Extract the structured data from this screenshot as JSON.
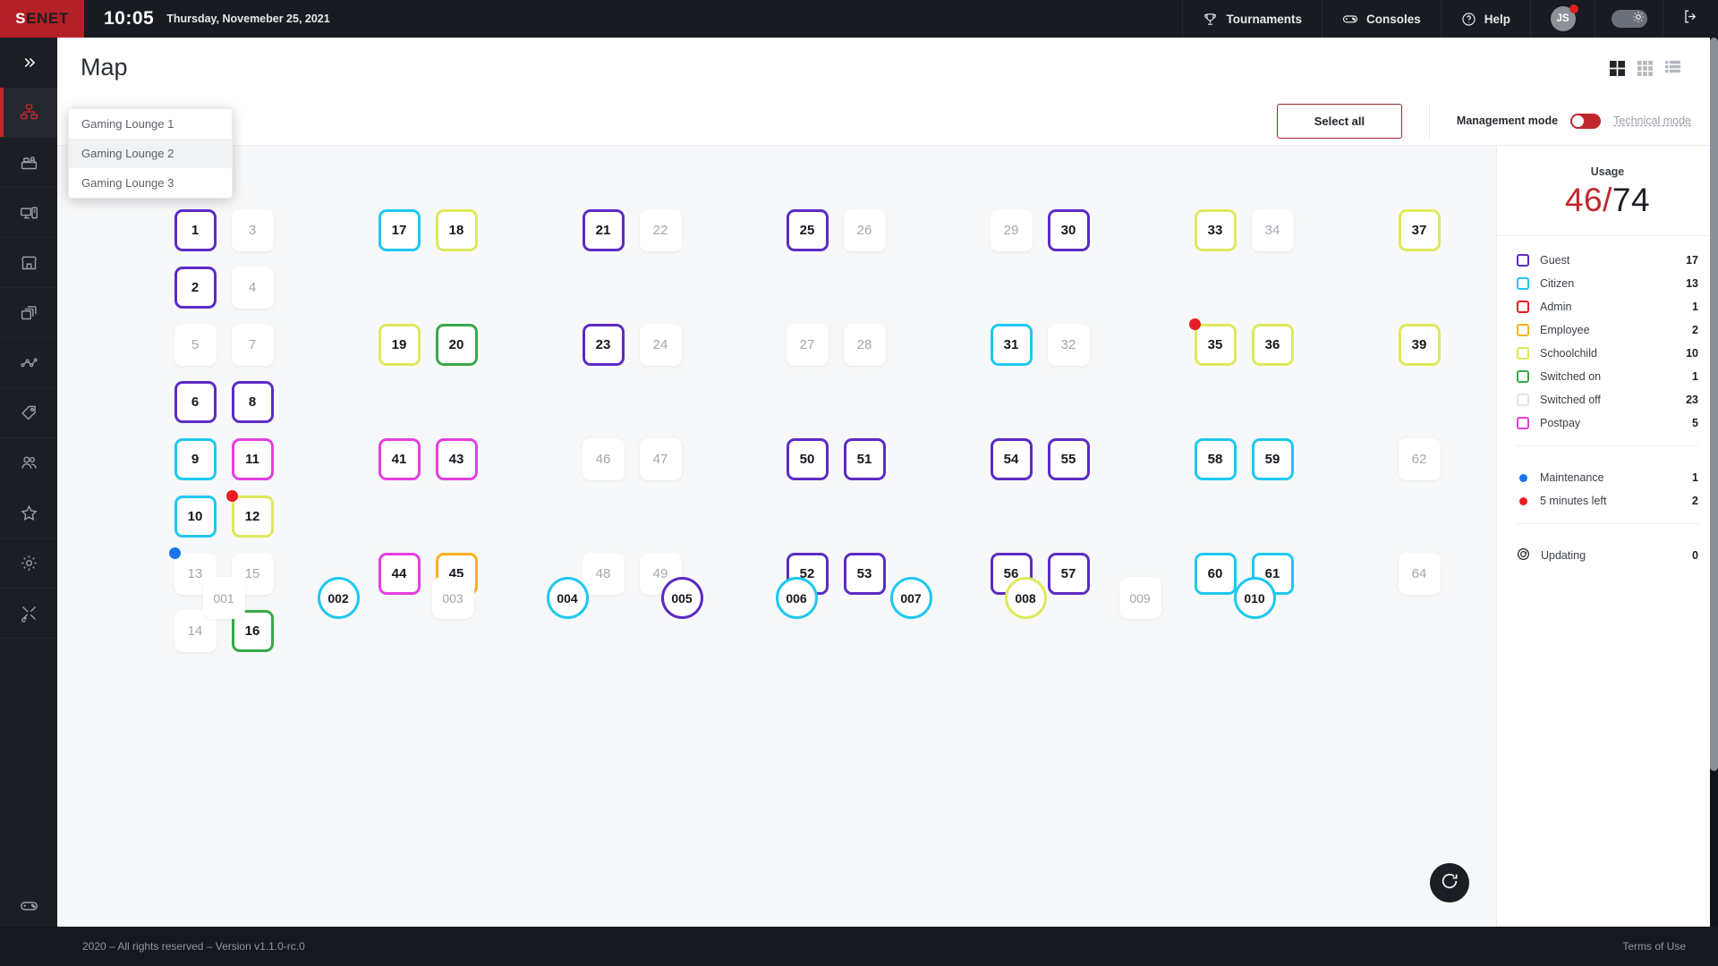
{
  "topbar": {
    "logo": "SENET",
    "logo_first_letter": "S",
    "logo_rest": "ENET",
    "clock": "10:05",
    "date": "Thursday, Novemeber 25, 2021",
    "items": [
      {
        "label": "Tournaments",
        "icon": "trophy-icon"
      },
      {
        "label": "Consoles",
        "icon": "gamepad-icon"
      },
      {
        "label": "Help",
        "icon": "help-circle-icon"
      }
    ],
    "avatar_initials": "JS",
    "theme_icon": "sun-icon",
    "logout_icon": "logout-icon"
  },
  "sidebar": {
    "expand_icon": "double-chevron-right-icon",
    "items": [
      {
        "icon": "network-map-icon",
        "name": "map",
        "active": true
      },
      {
        "icon": "reception-desk-icon",
        "name": "reception",
        "active": false
      },
      {
        "icon": "computer-icon",
        "name": "consoles",
        "active": false
      },
      {
        "icon": "shop-icon",
        "name": "shop",
        "active": false
      },
      {
        "icon": "layers-icon",
        "name": "layers",
        "active": false
      },
      {
        "icon": "analytics-icon",
        "name": "analytics",
        "active": false
      },
      {
        "icon": "tag-icon",
        "name": "pricing",
        "active": false
      },
      {
        "icon": "users-icon",
        "name": "users",
        "active": false
      },
      {
        "icon": "star-icon",
        "name": "favorites",
        "active": false
      },
      {
        "icon": "gear-icon",
        "name": "settings",
        "active": false
      },
      {
        "icon": "tools-icon",
        "name": "tools",
        "active": false
      }
    ],
    "bottom_items": [
      {
        "icon": "gamepad-icon",
        "name": "games",
        "active": false
      }
    ]
  },
  "page": {
    "title": "Map",
    "view_modes": [
      {
        "name": "grid-large",
        "active": true
      },
      {
        "name": "grid-small",
        "active": false
      },
      {
        "name": "list",
        "active": false
      }
    ]
  },
  "lounge_dropdown": {
    "options": [
      {
        "label": "Gaming Lounge 1",
        "selected": false
      },
      {
        "label": "Gaming Lounge 2",
        "selected": true
      },
      {
        "label": "Gaming Lounge 3",
        "selected": false
      }
    ]
  },
  "toolbar": {
    "select_all_label": "Select all",
    "management_mode_label": "Management mode",
    "management_mode_on": true,
    "technical_mode_label": "Technical mode"
  },
  "colors": {
    "guest": "#5B2BC4",
    "citizen": "#1EC8F0",
    "admin": "#ED1C24",
    "employee": "#F6B223",
    "schoolchild": "#DDE95C",
    "switched_on": "#38A84A",
    "switched_off": "#FFFFFF",
    "postpay": "#E33FE0",
    "maintenance": "#1976EA",
    "expiring": "#EC1C24",
    "brand_red": "#C0272D"
  },
  "usage": {
    "label": "Usage",
    "used": "46",
    "separator": "/",
    "total": "74"
  },
  "legend": {
    "categories": [
      {
        "label": "Guest",
        "count": "17",
        "color": "#5B2BC4"
      },
      {
        "label": "Citizen",
        "count": "13",
        "color": "#1EC8F0"
      },
      {
        "label": "Admin",
        "count": "1",
        "color": "#ED1C24"
      },
      {
        "label": "Employee",
        "count": "2",
        "color": "#F6B223"
      },
      {
        "label": "Schoolchild",
        "count": "10",
        "color": "#DDE95C"
      },
      {
        "label": "Switched on",
        "count": "1",
        "color": "#38A84A"
      },
      {
        "label": "Switched off",
        "count": "23",
        "color": "#E2E4E7"
      },
      {
        "label": "Postpay",
        "count": "5",
        "color": "#E33FE0"
      }
    ],
    "statuses": [
      {
        "label": "Maintenance",
        "count": "1",
        "color": "#1976EA"
      },
      {
        "label": "5 minutes left",
        "count": "2",
        "color": "#EC1C24"
      }
    ],
    "updating": {
      "label": "Updating",
      "count": "0",
      "icon": "refresh-icon"
    }
  },
  "stations": {
    "groups": [
      {
        "cells": [
          {
            "id": "1",
            "state": "guest",
            "badge": null
          },
          {
            "id": "2",
            "state": "guest",
            "badge": null
          },
          {
            "id": "5",
            "state": "off",
            "badge": null
          },
          {
            "id": "6",
            "state": "guest",
            "badge": null
          },
          {
            "id": "9",
            "state": "citizen",
            "badge": null
          },
          {
            "id": "10",
            "state": "citizen",
            "badge": null
          },
          {
            "id": "13",
            "state": "off",
            "badge": "maintenance"
          },
          {
            "id": "14",
            "state": "off",
            "badge": null
          }
        ],
        "cols2": [
          {
            "id": "3",
            "state": "off",
            "badge": null
          },
          {
            "id": "4",
            "state": "off",
            "badge": null
          },
          {
            "id": "7",
            "state": "off",
            "badge": null
          },
          {
            "id": "8",
            "state": "guest",
            "badge": null
          },
          {
            "id": "11",
            "state": "postpay",
            "badge": null
          },
          {
            "id": "12",
            "state": "schoolchild",
            "badge": "expiring"
          },
          {
            "id": "15",
            "state": "off",
            "badge": null
          },
          {
            "id": "16",
            "state": "switched_on",
            "badge": null
          }
        ]
      },
      {
        "cells": [
          {
            "id": "17",
            "state": "citizen",
            "badge": null
          },
          {
            "id": "18",
            "state": "schoolchild",
            "badge": null
          },
          {
            "id": "19",
            "state": "schoolchild",
            "badge": null
          },
          {
            "id": "20",
            "state": "switched_on",
            "badge": null
          },
          {
            "id": "41",
            "state": "postpay",
            "badge": null
          },
          {
            "id": "43",
            "state": "postpay",
            "badge": null
          },
          {
            "id": "44",
            "state": "postpay",
            "badge": null
          },
          {
            "id": "45",
            "state": "employee",
            "badge": null
          }
        ]
      },
      {
        "cells": [
          {
            "id": "21",
            "state": "guest",
            "badge": null
          },
          {
            "id": "22",
            "state": "off",
            "badge": null
          },
          {
            "id": "23",
            "state": "guest",
            "badge": null
          },
          {
            "id": "24",
            "state": "off",
            "badge": null
          },
          {
            "id": "46",
            "state": "off",
            "badge": null
          },
          {
            "id": "47",
            "state": "off",
            "badge": null
          },
          {
            "id": "48",
            "state": "off",
            "badge": null
          },
          {
            "id": "49",
            "state": "off",
            "badge": null
          }
        ]
      },
      {
        "cells": [
          {
            "id": "25",
            "state": "guest",
            "badge": null
          },
          {
            "id": "26",
            "state": "off",
            "badge": null
          },
          {
            "id": "27",
            "state": "off",
            "badge": null
          },
          {
            "id": "28",
            "state": "off",
            "badge": null
          },
          {
            "id": "50",
            "state": "guest",
            "badge": null
          },
          {
            "id": "51",
            "state": "guest",
            "badge": null
          },
          {
            "id": "52",
            "state": "guest",
            "badge": null
          },
          {
            "id": "53",
            "state": "guest",
            "badge": null
          }
        ]
      },
      {
        "cells": [
          {
            "id": "29",
            "state": "off",
            "badge": null
          },
          {
            "id": "30",
            "state": "guest",
            "badge": null
          },
          {
            "id": "31",
            "state": "citizen",
            "badge": null
          },
          {
            "id": "32",
            "state": "off",
            "badge": null
          },
          {
            "id": "54",
            "state": "guest",
            "badge": null
          },
          {
            "id": "55",
            "state": "guest",
            "badge": null
          },
          {
            "id": "56",
            "state": "guest",
            "badge": null
          },
          {
            "id": "57",
            "state": "guest",
            "badge": null
          }
        ]
      },
      {
        "cells": [
          {
            "id": "33",
            "state": "schoolchild",
            "badge": null
          },
          {
            "id": "34",
            "state": "off",
            "badge": null
          },
          {
            "id": "35",
            "state": "schoolchild",
            "badge": "expiring"
          },
          {
            "id": "36",
            "state": "schoolchild",
            "badge": null
          },
          {
            "id": "58",
            "state": "citizen",
            "badge": null
          },
          {
            "id": "59",
            "state": "citizen",
            "badge": null
          },
          {
            "id": "60",
            "state": "citizen",
            "badge": null
          },
          {
            "id": "61",
            "state": "citizen",
            "badge": null
          }
        ]
      },
      {
        "cells": [
          {
            "id": "37",
            "state": "schoolchild",
            "badge": null
          },
          {
            "id": "39",
            "state": "schoolchild",
            "badge": null
          },
          {
            "id": "62",
            "state": "off",
            "badge": null
          },
          {
            "id": "64",
            "state": "off",
            "badge": null
          }
        ],
        "single": true
      }
    ],
    "consoles": [
      {
        "id": "001",
        "state": "off"
      },
      {
        "id": "002",
        "state": "citizen"
      },
      {
        "id": "003",
        "state": "off"
      },
      {
        "id": "004",
        "state": "citizen"
      },
      {
        "id": "005",
        "state": "guest"
      },
      {
        "id": "006",
        "state": "citizen"
      },
      {
        "id": "007",
        "state": "citizen"
      },
      {
        "id": "008",
        "state": "schoolchild"
      },
      {
        "id": "009",
        "state": "off"
      },
      {
        "id": "010",
        "state": "citizen"
      }
    ]
  },
  "fab": {
    "icon": "refresh-icon"
  },
  "footer": {
    "copyright": "2020 – All rights reserved – Version v1.1.0-rc.0",
    "terms": "Terms of Use"
  }
}
